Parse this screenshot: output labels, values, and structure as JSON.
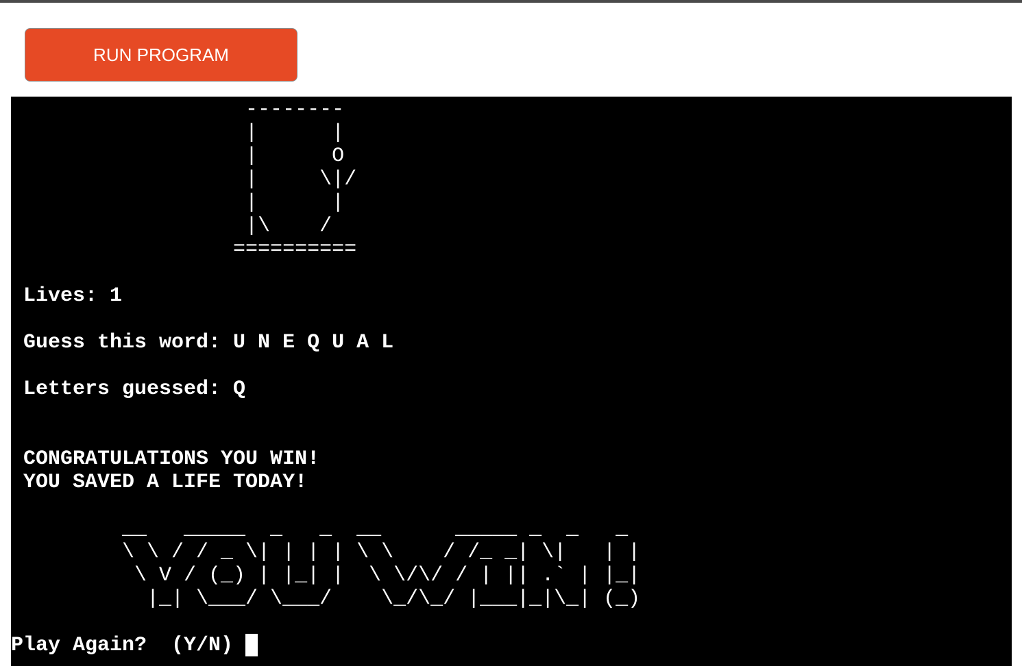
{
  "header": {
    "run_button": "RUN PROGRAM"
  },
  "terminal": {
    "hangman": [
      "                   --------",
      "                   |      |",
      "                   |      O",
      "                   |     \\|/",
      "                   |      |",
      "                   |\\    /",
      "                  =========="
    ],
    "lives_line": " Lives: 1",
    "word_line": " Guess this word: U N E Q U A L",
    "guessed_line": " Letters guessed: Q",
    "congrats_line": " CONGRATULATIONS YOU WIN!",
    "saved_line": " YOU SAVED A LIFE TODAY!",
    "you_win_art": [
      "         __   _____  _   _  __      _____ _  _   _",
      "         \\ \\ / / _ \\| | | | \\ \\    / /_ _| \\|   | |",
      "          \\ V / (_) | |_| |  \\ \\/\\/ / | || .` | |_|",
      "           |_| \\___/ \\___/    \\_/\\_/ |___|_|\\_| (_)"
    ],
    "prompt": "Play Again?  (Y/N) "
  }
}
